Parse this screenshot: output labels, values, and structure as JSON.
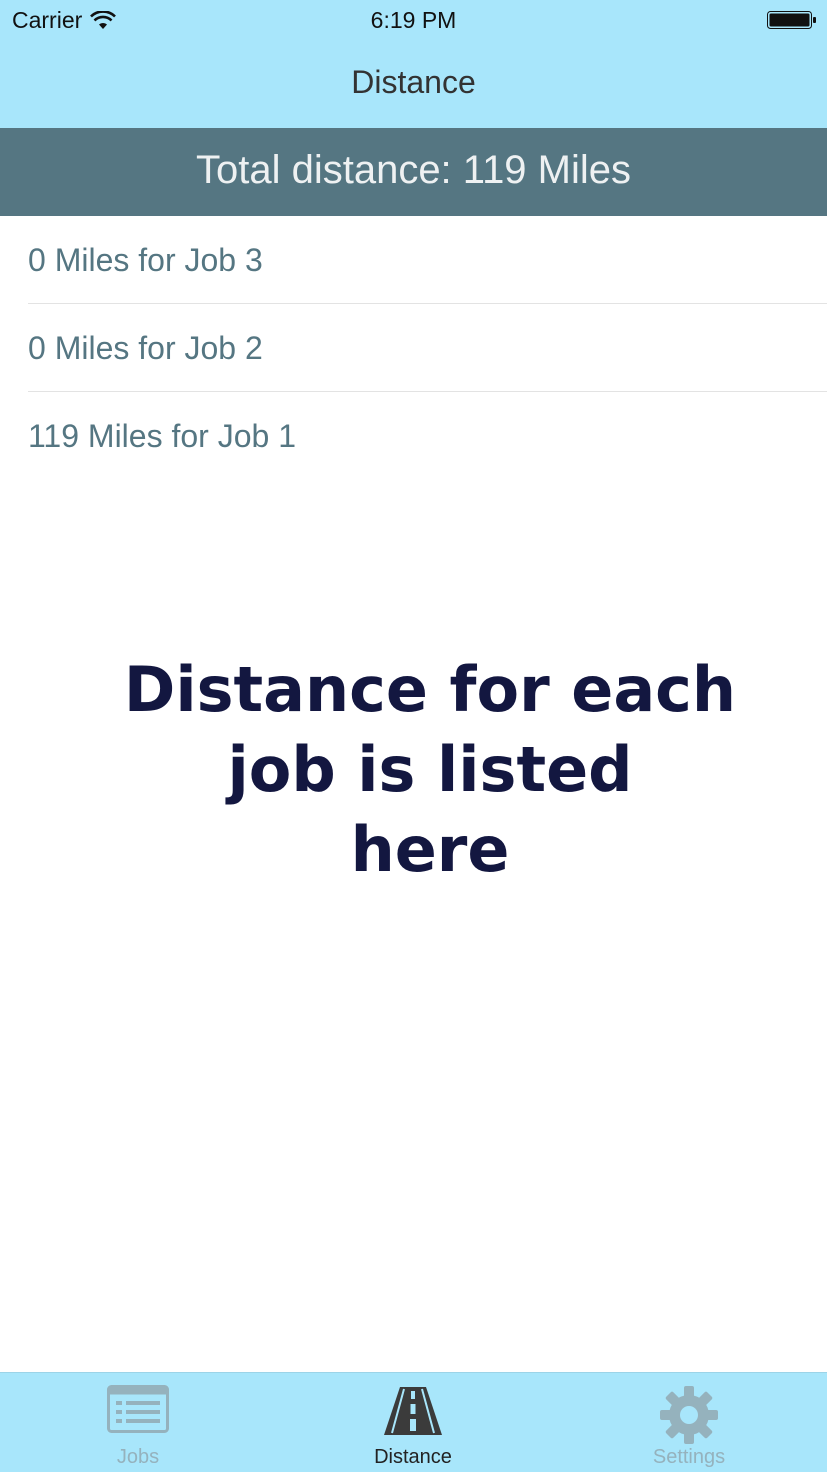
{
  "status_bar": {
    "carrier": "Carrier",
    "time": "6:19 PM"
  },
  "nav": {
    "title": "Distance"
  },
  "summary": {
    "total_text": "Total distance: 119 Miles"
  },
  "jobs": [
    {
      "label": "0 Miles for Job 3"
    },
    {
      "label": "0 Miles for Job 2"
    },
    {
      "label": "119 Miles for Job 1"
    }
  ],
  "annotation": {
    "text": "Distance for each\njob is listed\nhere"
  },
  "tab_bar": {
    "tabs": [
      {
        "label": "Jobs",
        "icon": "list-icon",
        "selected": false
      },
      {
        "label": "Distance",
        "icon": "road-icon",
        "selected": true
      },
      {
        "label": "Settings",
        "icon": "gear-icon",
        "selected": false
      }
    ]
  },
  "colors": {
    "nav_background": "#a8e6fb",
    "banner_background": "#557682",
    "row_text": "#557682",
    "annotation_text": "#131740",
    "inactive_tab": "#95b2bd",
    "active_tab": "#222222"
  }
}
